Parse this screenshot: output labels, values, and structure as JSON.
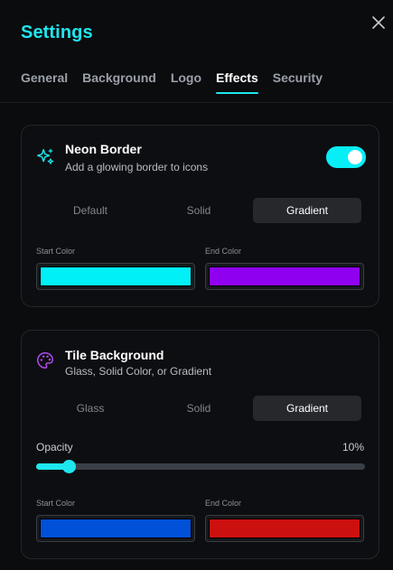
{
  "header": {
    "title": "Settings",
    "close_icon": "close-icon"
  },
  "tabs": [
    {
      "label": "General",
      "active": false
    },
    {
      "label": "Background",
      "active": false
    },
    {
      "label": "Logo",
      "active": false
    },
    {
      "label": "Effects",
      "active": true
    },
    {
      "label": "Security",
      "active": false
    }
  ],
  "neon_border": {
    "icon": "sparkles-icon",
    "title": "Neon Border",
    "subtitle": "Add a glowing border to icons",
    "enabled": true,
    "modes": [
      "Default",
      "Solid",
      "Gradient"
    ],
    "selected_mode": "Gradient",
    "start_color_label": "Start Color",
    "start_color": "#00f0f8",
    "end_color_label": "End Color",
    "end_color": "#9000f0"
  },
  "tile_background": {
    "icon": "palette-icon",
    "title": "Tile Background",
    "subtitle": "Glass, Solid Color, or Gradient",
    "modes": [
      "Glass",
      "Solid",
      "Gradient"
    ],
    "selected_mode": "Gradient",
    "opacity_label": "Opacity",
    "opacity_value": "10%",
    "opacity_fraction": 0.1,
    "start_color_label": "Start Color",
    "start_color": "#0050d8",
    "end_color_label": "End Color",
    "end_color": "#cc1010"
  },
  "colors": {
    "accent": "#1ee6ef",
    "active_tab_text": "#ffffff",
    "inactive_tab_text": "#9aa0a8"
  }
}
